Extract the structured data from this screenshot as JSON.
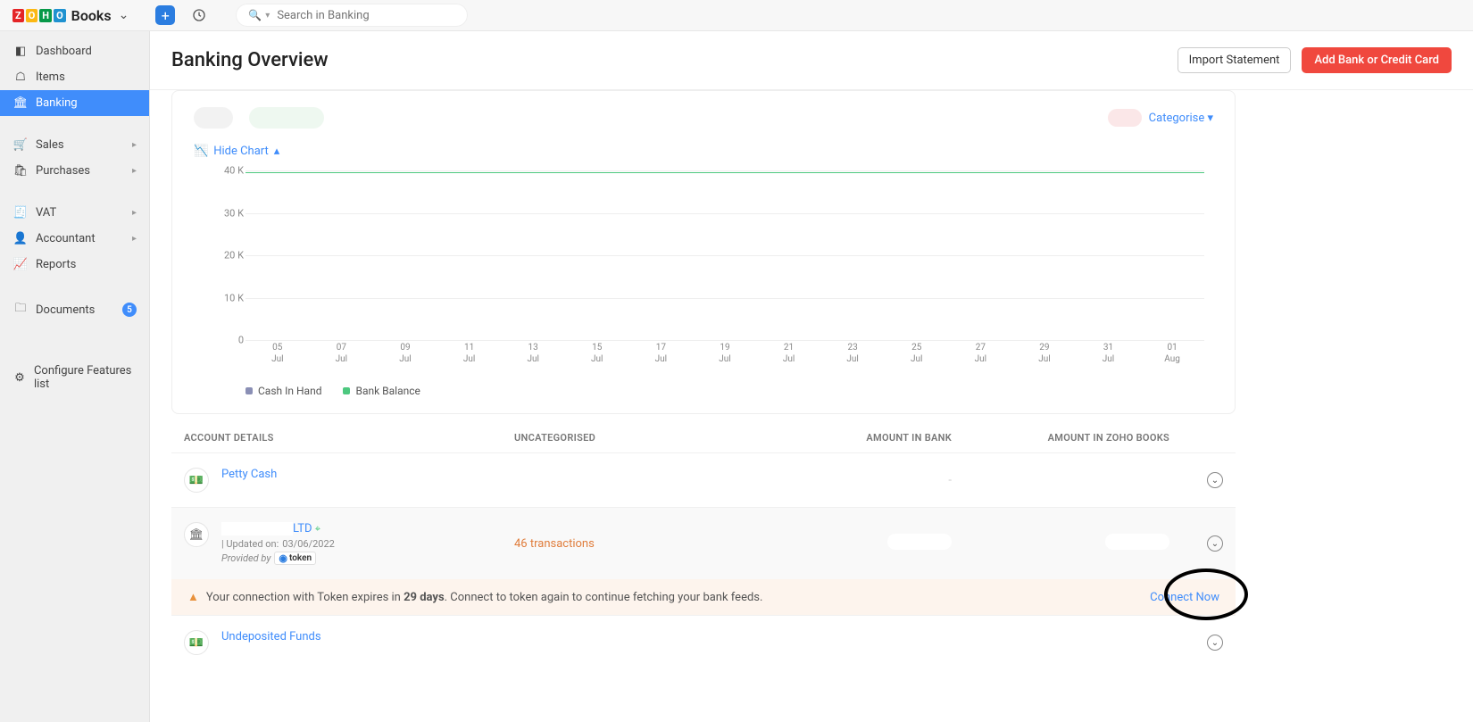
{
  "app": {
    "name": "Books"
  },
  "search": {
    "placeholder": "Search in Banking"
  },
  "sidebar": {
    "dashboard": "Dashboard",
    "items": "Items",
    "banking": "Banking",
    "sales": "Sales",
    "purchases": "Purchases",
    "vat": "VAT",
    "accountant": "Accountant",
    "reports": "Reports",
    "documents": "Documents",
    "documents_badge": "5",
    "configure": "Configure Features list"
  },
  "page": {
    "title": "Banking Overview",
    "import_btn": "Import Statement",
    "add_btn": "Add Bank or Credit Card"
  },
  "top_strip": {
    "categorise": "Categorise"
  },
  "chart_toggle": "Hide Chart",
  "chart_data": {
    "type": "line",
    "ylabel": "",
    "ylim": [
      0,
      42000
    ],
    "y_ticks": [
      "0",
      "10 K",
      "20 K",
      "30 K",
      "40 K"
    ],
    "x_ticks": [
      {
        "a": "05",
        "b": "Jul"
      },
      {
        "a": "07",
        "b": "Jul"
      },
      {
        "a": "09",
        "b": "Jul"
      },
      {
        "a": "11",
        "b": "Jul"
      },
      {
        "a": "13",
        "b": "Jul"
      },
      {
        "a": "15",
        "b": "Jul"
      },
      {
        "a": "17",
        "b": "Jul"
      },
      {
        "a": "19",
        "b": "Jul"
      },
      {
        "a": "21",
        "b": "Jul"
      },
      {
        "a": "23",
        "b": "Jul"
      },
      {
        "a": "25",
        "b": "Jul"
      },
      {
        "a": "27",
        "b": "Jul"
      },
      {
        "a": "29",
        "b": "Jul"
      },
      {
        "a": "31",
        "b": "Jul"
      },
      {
        "a": "01",
        "b": "Aug"
      }
    ],
    "series": [
      {
        "name": "Cash In Hand",
        "color": "#8a8fb5",
        "values": []
      },
      {
        "name": "Bank Balance",
        "color": "#4dc87f",
        "values": [
          42000,
          42000,
          42000,
          42000,
          42000,
          42000,
          42000,
          42000,
          42000,
          42000,
          42000,
          42000,
          42000,
          42000,
          42000
        ]
      }
    ]
  },
  "table": {
    "headers": {
      "account": "ACCOUNT DETAILS",
      "uncat": "UNCATEGORISED",
      "bank": "AMOUNT IN BANK",
      "zoho": "AMOUNT IN ZOHO BOOKS"
    },
    "rows": {
      "petty": {
        "name": "Petty Cash"
      },
      "bankacc": {
        "name_suffix": "LTD",
        "updated_prefix": "| Updated on: ",
        "updated": "03/06/2022",
        "provided_by": "Provided by",
        "provider": "token",
        "transactions": "46 transactions"
      },
      "undeposited": {
        "name": "Undeposited Funds"
      }
    }
  },
  "warning": {
    "text_pre": "Your connection with Token expires in ",
    "days": "29 days",
    "text_post": ". Connect to token again to continue fetching your bank feeds.",
    "connect": "Connect Now"
  }
}
